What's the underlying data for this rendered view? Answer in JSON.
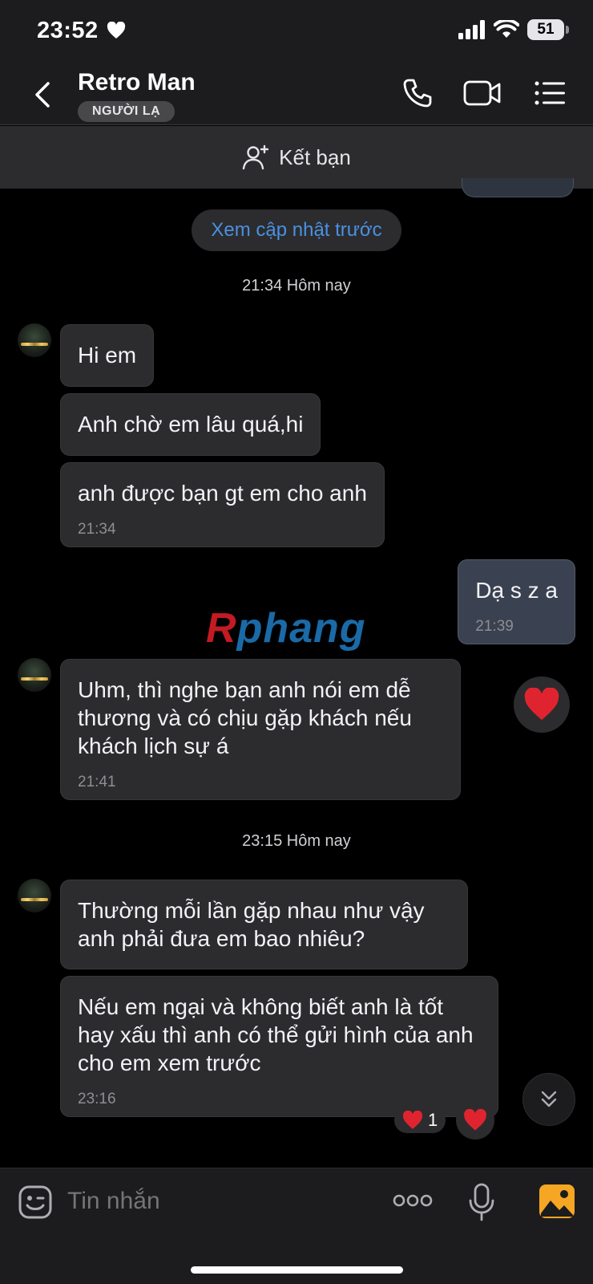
{
  "status_bar": {
    "time": "23:52",
    "battery": "51"
  },
  "header": {
    "contact_name": "Retro Man",
    "badge": "NGƯỜI LẠ"
  },
  "add_friend": {
    "label": "Kết bạn"
  },
  "chat": {
    "load_more": "Xem cập nhật trước",
    "separators": [
      "21:34 Hôm nay",
      "23:15 Hôm nay"
    ],
    "messages": [
      {
        "text": "Hi em"
      },
      {
        "text": "Anh chờ em lâu quá,hi"
      },
      {
        "text": "anh được bạn gt em cho anh",
        "time": "21:34"
      },
      {
        "text": "Dạ s z a",
        "time": "21:39"
      },
      {
        "text": "Uhm, thì nghe bạn anh nói em dễ thương và có chịu gặp khách nếu khách lịch sự á",
        "time": "21:41"
      },
      {
        "text": "Thường mỗi lần gặp nhau như vậy anh phải đưa em bao nhiêu?"
      },
      {
        "text": "Nếu em ngại và không biết anh là tốt hay xấu thì anh có thể gửi hình của anh cho em xem trước",
        "time": "23:16"
      }
    ],
    "reaction_count": "1",
    "watermark": {
      "part1": "R",
      "part2": "phang"
    }
  },
  "input": {
    "placeholder": "Tin nhắn"
  },
  "colors": {
    "accent": "#4a90e2",
    "heart": "#e0242f",
    "photo": "#f5a623"
  },
  "icons": [
    "heart-icon",
    "signal-icon",
    "wifi-icon",
    "back-icon",
    "phone-icon",
    "video-icon",
    "menu-icon",
    "add-friend-icon",
    "sticker-icon",
    "more-icon",
    "mic-icon",
    "photo-icon",
    "chevrons-down-icon"
  ]
}
